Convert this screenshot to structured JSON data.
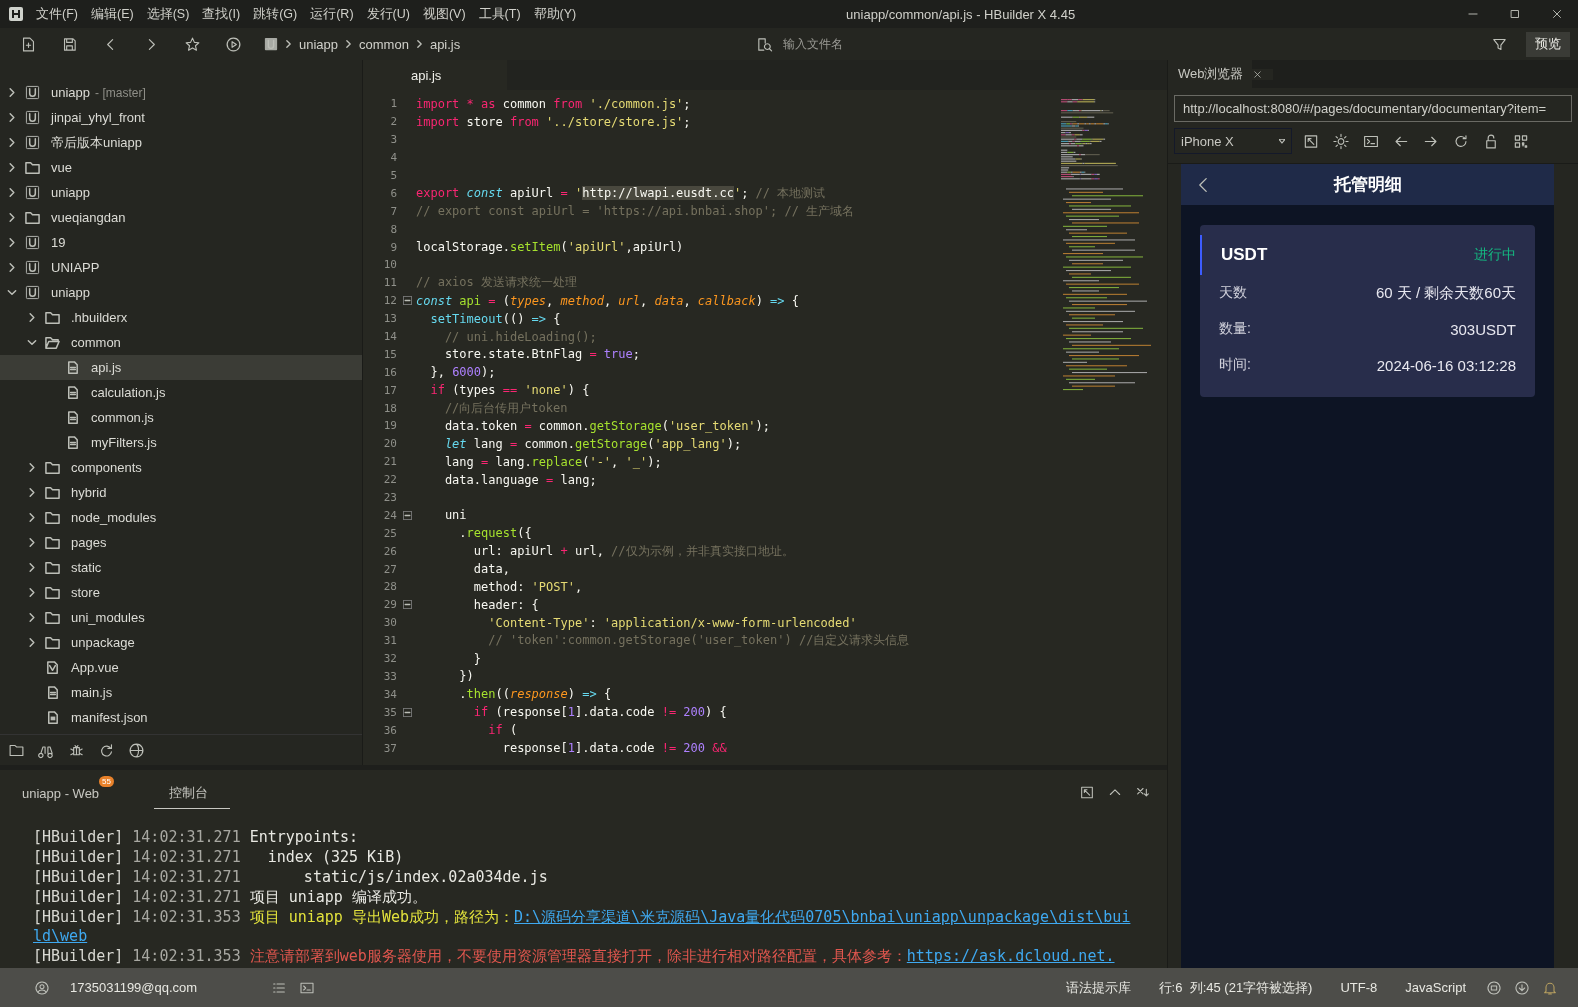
{
  "window": {
    "title": "uniapp/common/api.js - HBuilder X 4.45"
  },
  "menu": [
    "文件(F)",
    "编辑(E)",
    "选择(S)",
    "查找(I)",
    "跳转(G)",
    "运行(R)",
    "发行(U)",
    "视图(V)",
    "工具(T)",
    "帮助(Y)"
  ],
  "breadcrumb": [
    "uniapp",
    "common",
    "api.js"
  ],
  "file_search": {
    "placeholder": "输入文件名"
  },
  "preview_button": "预览",
  "tree": [
    {
      "label": "uniapp",
      "branch": "- [master]",
      "kind": "project",
      "expanded": false,
      "selected": false
    },
    {
      "label": "jinpai_yhyl_front",
      "kind": "project",
      "expanded": false,
      "selected": false
    },
    {
      "label": "帝后版本uniapp",
      "kind": "project",
      "expanded": false,
      "selected": false
    },
    {
      "label": "vue",
      "kind": "folder",
      "expanded": false,
      "selected": false
    },
    {
      "label": "uniapp",
      "kind": "project",
      "expanded": false,
      "selected": false
    },
    {
      "label": "vueqiangdan",
      "kind": "folder",
      "expanded": false,
      "selected": false
    },
    {
      "label": "19",
      "kind": "project",
      "expanded": false,
      "selected": false
    },
    {
      "label": "UNIAPP",
      "kind": "project",
      "expanded": false,
      "selected": false
    },
    {
      "label": "uniapp",
      "kind": "project",
      "expanded": true,
      "selected": false,
      "children": [
        {
          "label": ".hbuilderx",
          "kind": "folder",
          "expanded": false,
          "selected": false
        },
        {
          "label": "common",
          "kind": "folder",
          "expanded": true,
          "selected": false,
          "children": [
            {
              "label": "api.js",
              "kind": "file",
              "selected": true
            },
            {
              "label": "calculation.js",
              "kind": "file",
              "selected": false
            },
            {
              "label": "common.js",
              "kind": "file",
              "selected": false
            },
            {
              "label": "myFilters.js",
              "kind": "file",
              "selected": false
            }
          ]
        },
        {
          "label": "components",
          "kind": "folder",
          "expanded": false,
          "selected": false
        },
        {
          "label": "hybrid",
          "kind": "folder",
          "expanded": false,
          "selected": false
        },
        {
          "label": "node_modules",
          "kind": "folder",
          "expanded": false,
          "selected": false
        },
        {
          "label": "pages",
          "kind": "folder",
          "expanded": false,
          "selected": false
        },
        {
          "label": "static",
          "kind": "folder",
          "expanded": false,
          "selected": false
        },
        {
          "label": "store",
          "kind": "folder",
          "expanded": false,
          "selected": false
        },
        {
          "label": "uni_modules",
          "kind": "folder",
          "expanded": false,
          "selected": false
        },
        {
          "label": "unpackage",
          "kind": "folder",
          "expanded": false,
          "selected": false
        },
        {
          "label": "App.vue",
          "kind": "vue",
          "selected": false
        },
        {
          "label": "main.js",
          "kind": "file",
          "selected": false
        },
        {
          "label": "manifest.json",
          "kind": "json",
          "selected": false
        }
      ]
    }
  ],
  "editor_tabs": [
    {
      "label": "api.js",
      "selected": true
    }
  ],
  "code": [
    {
      "no": "1",
      "tokens": [
        {
          "kind": "kw",
          "text": "import "
        },
        {
          "kind": "kw",
          "text": "* "
        },
        {
          "kind": "kw",
          "text": "as "
        },
        {
          "kind": "p",
          "text": "common "
        },
        {
          "kind": "kw",
          "text": "from "
        },
        {
          "kind": "s",
          "text": "'./common.js'"
        },
        {
          "kind": "p",
          "text": ";"
        }
      ]
    },
    {
      "no": "2",
      "tokens": [
        {
          "kind": "kw",
          "text": "import "
        },
        {
          "kind": "p",
          "text": "store "
        },
        {
          "kind": "kw",
          "text": "from "
        },
        {
          "kind": "s",
          "text": "'../store/store.js'"
        },
        {
          "kind": "p",
          "text": ";"
        }
      ]
    },
    {
      "no": "3"
    },
    {
      "no": "4"
    },
    {
      "no": "5"
    },
    {
      "no": "6",
      "tokens": [
        {
          "kind": "kw",
          "text": "export "
        },
        {
          "kind": "st",
          "text": "const "
        },
        {
          "kind": "p",
          "text": "apiUrl "
        },
        {
          "kind": "kw",
          "text": "= "
        },
        {
          "kind": "s",
          "text": "'"
        },
        {
          "kind": "sel",
          "text": "http://lwapi.eusdt.cc"
        },
        {
          "kind": "s",
          "text": "'"
        },
        {
          "kind": "p",
          "text": "; "
        },
        {
          "kind": "c",
          "text": "// 本地测试"
        }
      ]
    },
    {
      "no": "7",
      "tokens": [
        {
          "kind": "c",
          "text": "// export const apiUrl = 'https://api.bnbai.shop'; // 生产域名"
        }
      ]
    },
    {
      "no": "8"
    },
    {
      "no": "9",
      "tokens": [
        {
          "kind": "p",
          "text": "localStorage."
        },
        {
          "kind": "f",
          "text": "setItem"
        },
        {
          "kind": "p",
          "text": "("
        },
        {
          "kind": "s",
          "text": "'apiUrl'"
        },
        {
          "kind": "p",
          "text": ",apiUrl)"
        }
      ]
    },
    {
      "no": "10"
    },
    {
      "no": "11",
      "tokens": [
        {
          "kind": "c",
          "text": "// axios 发送请求统一处理"
        }
      ]
    },
    {
      "no": "12",
      "fold": true,
      "tokens": [
        {
          "kind": "st",
          "text": "const "
        },
        {
          "kind": "f",
          "text": "api "
        },
        {
          "kind": "kw",
          "text": "= "
        },
        {
          "kind": "p",
          "text": "("
        },
        {
          "kind": "a",
          "text": "types"
        },
        {
          "kind": "p",
          "text": ", "
        },
        {
          "kind": "a",
          "text": "method"
        },
        {
          "kind": "p",
          "text": ", "
        },
        {
          "kind": "a",
          "text": "url"
        },
        {
          "kind": "p",
          "text": ", "
        },
        {
          "kind": "a",
          "text": "data"
        },
        {
          "kind": "p",
          "text": ", "
        },
        {
          "kind": "a",
          "text": "callback"
        },
        {
          "kind": "p",
          "text": ") "
        },
        {
          "kind": "ar",
          "text": "=> "
        },
        {
          "kind": "p",
          "text": "{"
        }
      ]
    },
    {
      "no": "13",
      "tokens": [
        {
          "kind": "ar",
          "text": "  setTimeout"
        },
        {
          "kind": "p",
          "text": "(() "
        },
        {
          "kind": "ar",
          "text": "=> "
        },
        {
          "kind": "p",
          "text": "{"
        }
      ]
    },
    {
      "no": "14",
      "tokens": [
        {
          "kind": "c",
          "text": "    // uni.hideLoading();"
        }
      ]
    },
    {
      "no": "15",
      "tokens": [
        {
          "kind": "p",
          "text": "    store.state.BtnFlag "
        },
        {
          "kind": "kw",
          "text": "= "
        },
        {
          "kind": "n",
          "text": "true"
        },
        {
          "kind": "p",
          "text": ";"
        }
      ]
    },
    {
      "no": "16",
      "tokens": [
        {
          "kind": "p",
          "text": "  }, "
        },
        {
          "kind": "n",
          "text": "6000"
        },
        {
          "kind": "p",
          "text": ");"
        }
      ]
    },
    {
      "no": "17",
      "tokens": [
        {
          "kind": "kw",
          "text": "  if "
        },
        {
          "kind": "p",
          "text": "(types "
        },
        {
          "kind": "kw",
          "text": "== "
        },
        {
          "kind": "s",
          "text": "'none'"
        },
        {
          "kind": "p",
          "text": ") {"
        }
      ]
    },
    {
      "no": "18",
      "tokens": [
        {
          "kind": "c",
          "text": "    //向后台传用户token"
        }
      ]
    },
    {
      "no": "19",
      "tokens": [
        {
          "kind": "p",
          "text": "    data.token "
        },
        {
          "kind": "kw",
          "text": "= "
        },
        {
          "kind": "p",
          "text": "common."
        },
        {
          "kind": "f",
          "text": "getStorage"
        },
        {
          "kind": "p",
          "text": "("
        },
        {
          "kind": "s",
          "text": "'user_token'"
        },
        {
          "kind": "p",
          "text": ");"
        }
      ]
    },
    {
      "no": "20",
      "tokens": [
        {
          "kind": "st",
          "text": "    let "
        },
        {
          "kind": "p",
          "text": "lang "
        },
        {
          "kind": "kw",
          "text": "= "
        },
        {
          "kind": "p",
          "text": "common."
        },
        {
          "kind": "f",
          "text": "getStorage"
        },
        {
          "kind": "p",
          "text": "("
        },
        {
          "kind": "s",
          "text": "'app_lang'"
        },
        {
          "kind": "p",
          "text": ");"
        }
      ]
    },
    {
      "no": "21",
      "tokens": [
        {
          "kind": "p",
          "text": "    lang "
        },
        {
          "kind": "kw",
          "text": "= "
        },
        {
          "kind": "p",
          "text": "lang."
        },
        {
          "kind": "f",
          "text": "replace"
        },
        {
          "kind": "p",
          "text": "("
        },
        {
          "kind": "s",
          "text": "'-'"
        },
        {
          "kind": "p",
          "text": ", "
        },
        {
          "kind": "s",
          "text": "'_'"
        },
        {
          "kind": "p",
          "text": ");"
        }
      ]
    },
    {
      "no": "22",
      "tokens": [
        {
          "kind": "p",
          "text": "    data.language "
        },
        {
          "kind": "kw",
          "text": "= "
        },
        {
          "kind": "p",
          "text": "lang;"
        }
      ]
    },
    {
      "no": "23"
    },
    {
      "no": "24",
      "fold": true,
      "tokens": [
        {
          "kind": "p",
          "text": "    uni"
        }
      ]
    },
    {
      "no": "25",
      "tokens": [
        {
          "kind": "p",
          "text": "      ."
        },
        {
          "kind": "f",
          "text": "request"
        },
        {
          "kind": "p",
          "text": "({"
        }
      ]
    },
    {
      "no": "26",
      "tokens": [
        {
          "kind": "p",
          "text": "        url: apiUrl "
        },
        {
          "kind": "kw",
          "text": "+ "
        },
        {
          "kind": "p",
          "text": "url, "
        },
        {
          "kind": "c",
          "text": "//仅为示例，并非真实接口地址。"
        }
      ]
    },
    {
      "no": "27",
      "tokens": [
        {
          "kind": "p",
          "text": "        data,"
        }
      ]
    },
    {
      "no": "28",
      "tokens": [
        {
          "kind": "p",
          "text": "        method: "
        },
        {
          "kind": "s",
          "text": "'POST'"
        },
        {
          "kind": "p",
          "text": ","
        }
      ]
    },
    {
      "no": "29",
      "fold": true,
      "tokens": [
        {
          "kind": "p",
          "text": "        header: {"
        }
      ]
    },
    {
      "no": "30",
      "tokens": [
        {
          "kind": "s",
          "text": "          'Content-Type'"
        },
        {
          "kind": "p",
          "text": ": "
        },
        {
          "kind": "s",
          "text": "'application/x-www-form-urlencoded'"
        }
      ]
    },
    {
      "no": "31",
      "tokens": [
        {
          "kind": "c",
          "text": "          // 'token':common.getStorage('user_token') //自定义请求头信息"
        }
      ]
    },
    {
      "no": "32",
      "tokens": [
        {
          "kind": "p",
          "text": "        }"
        }
      ]
    },
    {
      "no": "33",
      "tokens": [
        {
          "kind": "p",
          "text": "      })"
        }
      ]
    },
    {
      "no": "34",
      "tokens": [
        {
          "kind": "p",
          "text": "      ."
        },
        {
          "kind": "f",
          "text": "then"
        },
        {
          "kind": "p",
          "text": "(("
        },
        {
          "kind": "a",
          "text": "response"
        },
        {
          "kind": "p",
          "text": ") "
        },
        {
          "kind": "ar",
          "text": "=> "
        },
        {
          "kind": "p",
          "text": "{"
        }
      ]
    },
    {
      "no": "35",
      "fold": true,
      "tokens": [
        {
          "kind": "kw",
          "text": "        if "
        },
        {
          "kind": "p",
          "text": "(response["
        },
        {
          "kind": "n",
          "text": "1"
        },
        {
          "kind": "p",
          "text": "].data.code "
        },
        {
          "kind": "kw",
          "text": "!= "
        },
        {
          "kind": "n",
          "text": "200"
        },
        {
          "kind": "p",
          "text": ") {"
        }
      ]
    },
    {
      "no": "36",
      "tokens": [
        {
          "kind": "kw",
          "text": "          if "
        },
        {
          "kind": "p",
          "text": "("
        }
      ]
    },
    {
      "no": "37",
      "tokens": [
        {
          "kind": "p",
          "text": "            response["
        },
        {
          "kind": "n",
          "text": "1"
        },
        {
          "kind": "p",
          "text": "].data.code "
        },
        {
          "kind": "kw",
          "text": "!= "
        },
        {
          "kind": "n",
          "text": "200 "
        },
        {
          "kind": "kw",
          "text": "&&"
        }
      ]
    }
  ],
  "browser": {
    "tab": "Web浏览器",
    "url": "http://localhost:8080/#/pages/documentary/documentary?item=",
    "device": "iPhone X",
    "page": {
      "title": "托管明细",
      "coin": "USDT",
      "status": "进行中",
      "rows": [
        {
          "label": "天数",
          "value": "60 天 / 剩余天数60天"
        },
        {
          "label": "数量:",
          "value": "303USDT"
        },
        {
          "label": "时间:",
          "value": "2024-06-16 03:12:28"
        }
      ]
    }
  },
  "console_tabs": [
    {
      "label": "uniapp - Web",
      "badge": "55",
      "selected": false
    },
    {
      "label": "控制台",
      "selected": true
    }
  ],
  "console": [
    {
      "tag": "[HBuilder]",
      "time": "14:02:31.271",
      "parts": [
        {
          "kind": "t",
          "text": "Entrypoints:"
        }
      ]
    },
    {
      "tag": "[HBuilder]",
      "time": "14:02:31.271",
      "parts": [
        {
          "kind": "t",
          "text": "  index (325 KiB)"
        }
      ]
    },
    {
      "tag": "[HBuilder]",
      "time": "14:02:31.271",
      "parts": [
        {
          "kind": "t",
          "text": "      static/js/index.02a034de.js"
        }
      ]
    },
    {
      "tag": "[HBuilder]",
      "time": "14:02:31.271",
      "parts": [
        {
          "kind": "t",
          "text": "项目 uniapp 编译成功。"
        }
      ]
    },
    {
      "tag": "[HBuilder]",
      "time": "14:02:31.353",
      "parts": [
        {
          "kind": "y",
          "text": "项目 uniapp 导出Web成功，路径为："
        },
        {
          "kind": "l",
          "text": "D:\\源码分享渠道\\米克源码\\Java量化代码0705\\bnbai\\uniapp\\unpackage\\dist\\bui"
        }
      ]
    },
    {
      "parts": [
        {
          "kind": "l",
          "text": "ld\\web"
        }
      ]
    },
    {
      "tag": "[HBuilder]",
      "time": "14:02:31.353",
      "parts": [
        {
          "kind": "r",
          "text": "注意请部署到web服务器使用，不要使用资源管理器直接打开，除非进行相对路径配置，具体参考："
        },
        {
          "kind": "l",
          "text": "https://ask.dcloud.net."
        }
      ]
    }
  ],
  "status_bar": {
    "account": "1735031199@qq.com",
    "hint_library": "语法提示库",
    "position": "行:6  列:45 (21字符被选择)",
    "encoding": "UTF-8",
    "language": "JavaScript"
  }
}
